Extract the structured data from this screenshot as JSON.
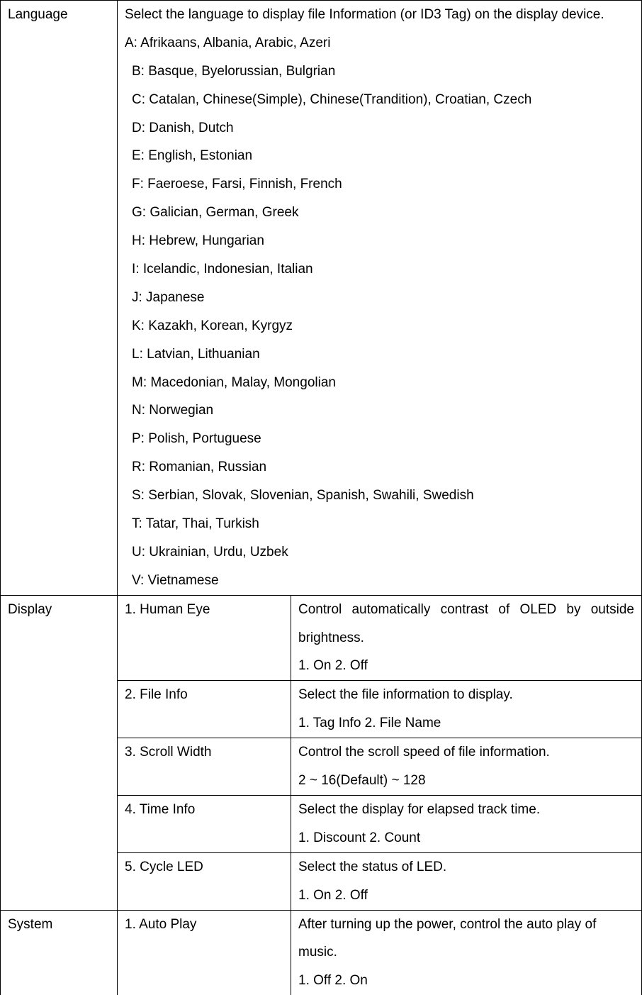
{
  "rows": {
    "language": {
      "label": "Language",
      "intro": "Select the language to display file Information (or ID3 Tag) on the display device.",
      "firstLine": "A: Afrikaans, Albania, Arabic, Azeri",
      "lines": [
        "B: Basque, Byelorussian, Bulgrian",
        "C: Catalan, Chinese(Simple), Chinese(Trandition), Croatian, Czech",
        "D: Danish, Dutch",
        "E: English, Estonian",
        "F: Faeroese, Farsi, Finnish, French",
        "G: Galician, German, Greek",
        "H: Hebrew, Hungarian",
        "I: Icelandic, Indonesian, Italian",
        "J: Japanese",
        "K: Kazakh, Korean, Kyrgyz",
        "L: Latvian, Lithuanian",
        "M: Macedonian, Malay, Mongolian",
        "N: Norwegian",
        "P: Polish, Portuguese",
        "R: Romanian, Russian",
        "S: Serbian, Slovak, Slovenian, Spanish, Swahili, Swedish",
        "T: Tatar, Thai, Turkish",
        "U: Ukrainian, Urdu, Uzbek",
        "V: Vietnamese"
      ]
    },
    "display": {
      "label": "Display",
      "items": [
        {
          "name": "1. Human Eye",
          "desc": "Control automatically contrast of OLED by outside brightness.",
          "opts": "1. On 2. Off",
          "justify": true
        },
        {
          "name": "2. File Info",
          "desc": "Select the file information to display.",
          "opts": "1. Tag Info 2. File Name",
          "justify": false
        },
        {
          "name": "3. Scroll Width",
          "desc": "Control the scroll speed of file information.",
          "opts": "2 ~ 16(Default) ~ 128",
          "justify": false
        },
        {
          "name": "4. Time Info",
          "desc": "Select the display for elapsed track time.",
          "opts": "1. Discount 2. Count",
          "justify": false
        },
        {
          "name": "5. Cycle LED",
          "desc": "Select the status of LED.",
          "opts": "1. On 2. Off",
          "justify": false
        }
      ]
    },
    "system": {
      "label": "System",
      "items": [
        {
          "name": "1. Auto Play",
          "desc": "After turning up the power, control the auto play of music.",
          "opts": "1. Off 2. On",
          "justify": false
        }
      ]
    }
  }
}
